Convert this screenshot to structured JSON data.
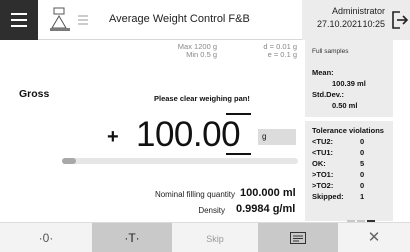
{
  "header": {
    "title": "Average Weight Control F&B",
    "user": "Administrator",
    "date": "27.10.2021",
    "time": "10:25"
  },
  "scale_specs": {
    "max": "Max 1200 g",
    "min": "Min 0.5 g",
    "d": "d = 0.01 g",
    "e": "e = 0.1 g"
  },
  "weighing": {
    "mode_label": "Gross",
    "message": "Please clear weighing pan!",
    "sign": "+",
    "value": "100.00",
    "unit": "g",
    "progress_fraction": 0.06
  },
  "info": {
    "nominal_label": "Nominal filling quantity",
    "nominal_value": "100.000 ml",
    "density_label": "Density",
    "density_value": "0.9984 g/ml"
  },
  "side_panel": {
    "title": "Full samples",
    "mean_label": "Mean:",
    "mean_value": "100.39 ml",
    "std_label": "Std.Dev.:",
    "std_value": "0.50 ml",
    "tol_title": "Tolerance violations",
    "tolerance": [
      {
        "label": "<TU2:",
        "value": "0"
      },
      {
        "label": "<TU1:",
        "value": "0"
      },
      {
        "label": "OK:",
        "value": "5"
      },
      {
        "label": ">TO1:",
        "value": "0"
      },
      {
        "label": ">TO2:",
        "value": "0"
      },
      {
        "label": "Skipped:",
        "value": "1"
      }
    ]
  },
  "bottom_bar": {
    "zero_label": "·0·",
    "tare_label": "·T·",
    "skip_label": "Skip",
    "close_label": "✕"
  },
  "colors": {
    "menu_bg": "#2e2e2e",
    "panel_bg": "#ececec",
    "accent_button": "#c9c9c9"
  }
}
